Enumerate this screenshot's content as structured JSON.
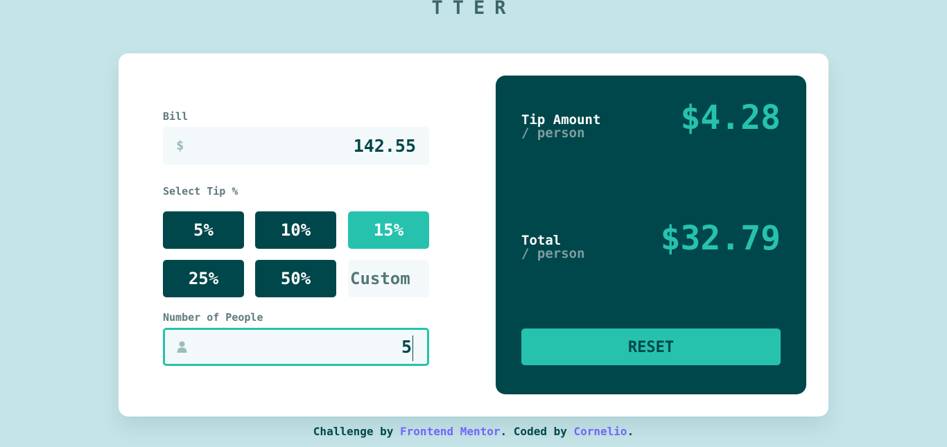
{
  "header": {
    "logo_text": "TTER"
  },
  "bill": {
    "label": "Bill",
    "currency_symbol": "$",
    "value": "142.55"
  },
  "tip": {
    "label": "Select Tip %",
    "options": [
      "5%",
      "10%",
      "15%",
      "25%",
      "50%"
    ],
    "selected": "15%",
    "custom_placeholder": "Custom"
  },
  "people": {
    "label": "Number of People",
    "value": "5"
  },
  "results": {
    "tip_amount_label": "Tip Amount",
    "tip_amount_sub": "/ person",
    "tip_amount_value": "$4.28",
    "total_label": "Total",
    "total_sub": "/ person",
    "total_value": "$32.79",
    "reset_label": "RESET"
  },
  "footer": {
    "text_1": "Challenge by ",
    "link_1": "Frontend Mentor",
    "text_2": ". Coded by ",
    "link_2": "Cornelio",
    "text_3": "."
  },
  "colors": {
    "background": "#c5e4e7",
    "dark_cyan": "#00474b",
    "strong_cyan": "#26c2ae",
    "link": "#6f66ff"
  }
}
